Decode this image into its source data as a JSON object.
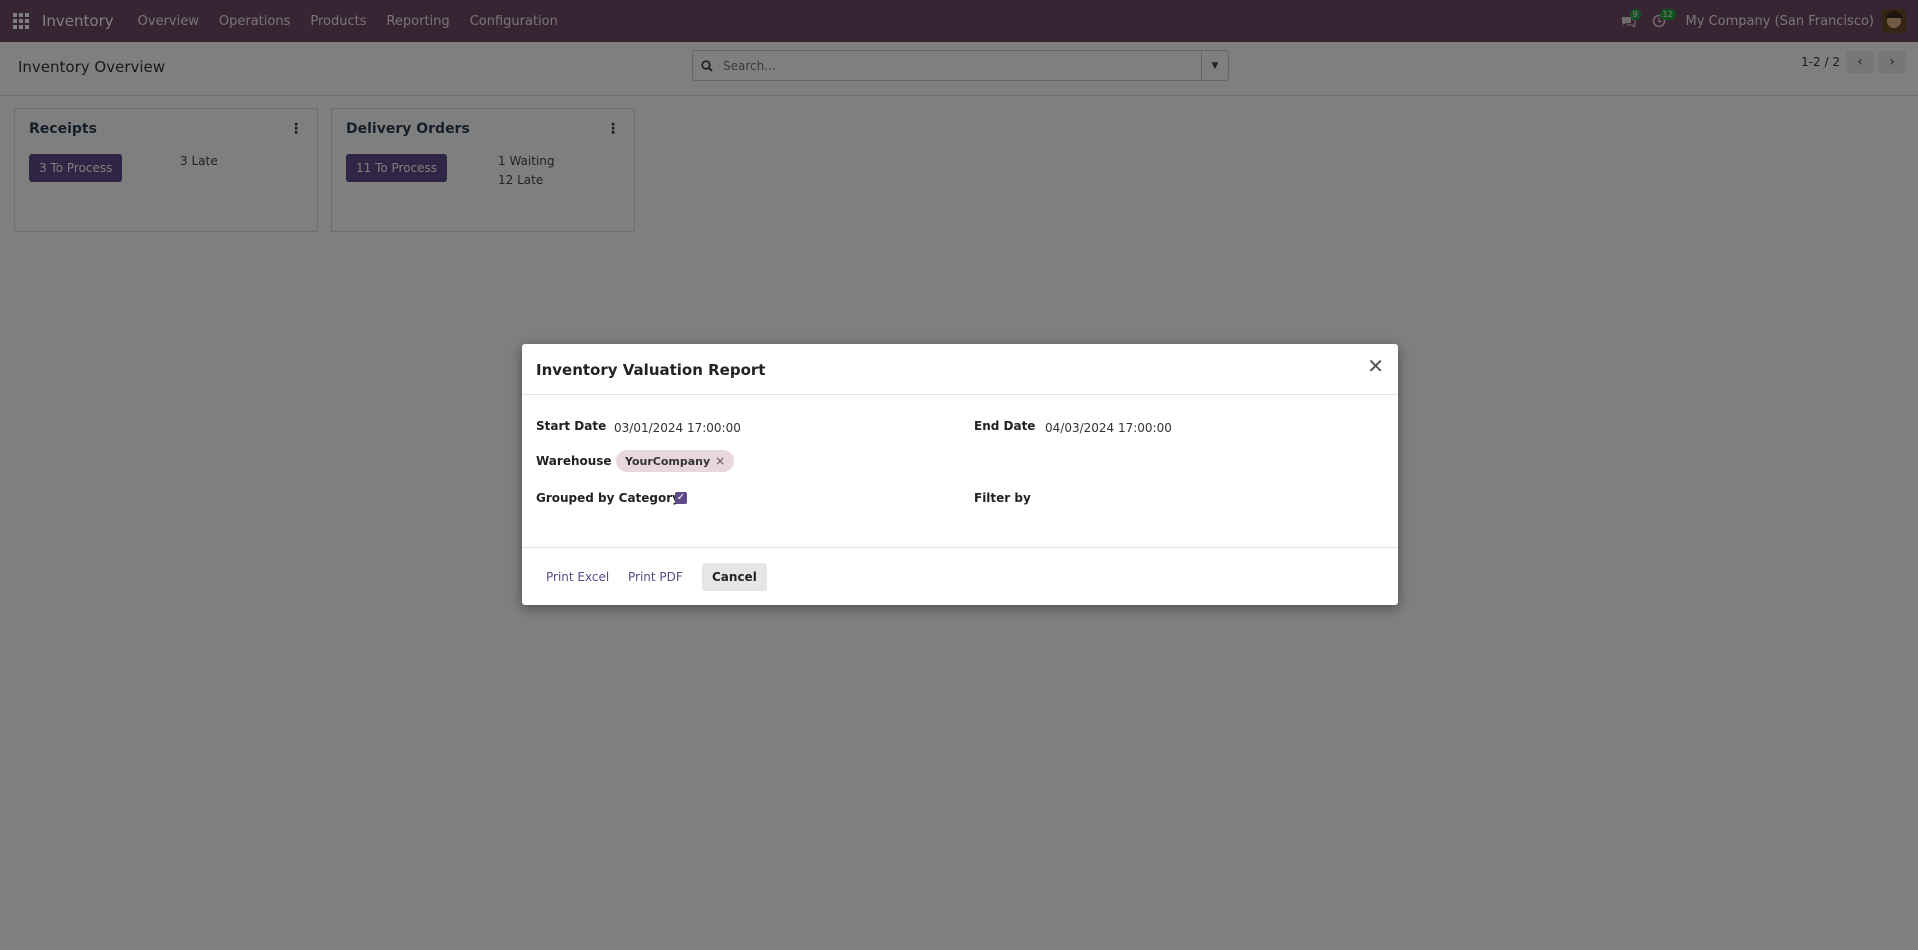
{
  "topbar": {
    "app_name": "Inventory",
    "menu": [
      "Overview",
      "Operations",
      "Products",
      "Reporting",
      "Configuration"
    ],
    "messages_badge": "9",
    "activities_badge": "12",
    "company": "My Company (San Francisco)"
  },
  "control": {
    "page_title": "Inventory Overview",
    "search_placeholder": "Search...",
    "pager": "1-2 / 2"
  },
  "cards": [
    {
      "title": "Receipts",
      "button": "3 To Process",
      "stats": [
        "3 Late"
      ]
    },
    {
      "title": "Delivery Orders",
      "button": "11 To Process",
      "stats": [
        "1 Waiting",
        "12 Late"
      ]
    }
  ],
  "dialog": {
    "title": "Inventory Valuation Report",
    "start_date_label": "Start Date",
    "start_date": "03/01/2024 17:00:00",
    "end_date_label": "End Date",
    "end_date": "04/03/2024 17:00:00",
    "warehouse_label": "Warehouse",
    "warehouse_tag": "YourCompany",
    "grouped_label": "Grouped by Category",
    "grouped_checked": true,
    "filter_label": "Filter by",
    "buttons": {
      "excel": "Print Excel",
      "pdf": "Print PDF",
      "cancel": "Cancel"
    }
  },
  "colors": {
    "topbar": "#714b67",
    "primary_button": "#5e4a88",
    "tag": "#e8d7dd"
  }
}
